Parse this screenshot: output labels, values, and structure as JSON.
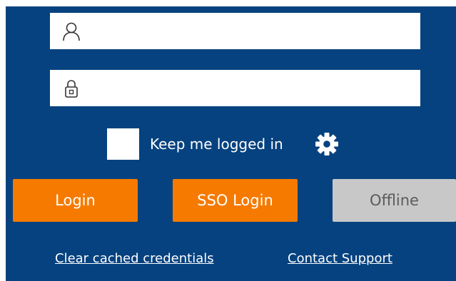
{
  "username": {
    "value": "",
    "placeholder": "",
    "icon": "user-icon"
  },
  "password": {
    "value": "",
    "placeholder": "",
    "icon": "lock-icon"
  },
  "keep_logged_in": {
    "label": "Keep me logged in",
    "checked": false
  },
  "settings": {
    "icon": "gear-icon"
  },
  "buttons": {
    "login": "Login",
    "sso_login": "SSO Login",
    "offline": "Offline"
  },
  "links": {
    "clear_cache": "Clear cached credentials",
    "contact_support": "Contact Support"
  },
  "colors": {
    "background": "#06427f",
    "primary_button": "#f67a00",
    "disabled_button": "#c8c8c8"
  }
}
